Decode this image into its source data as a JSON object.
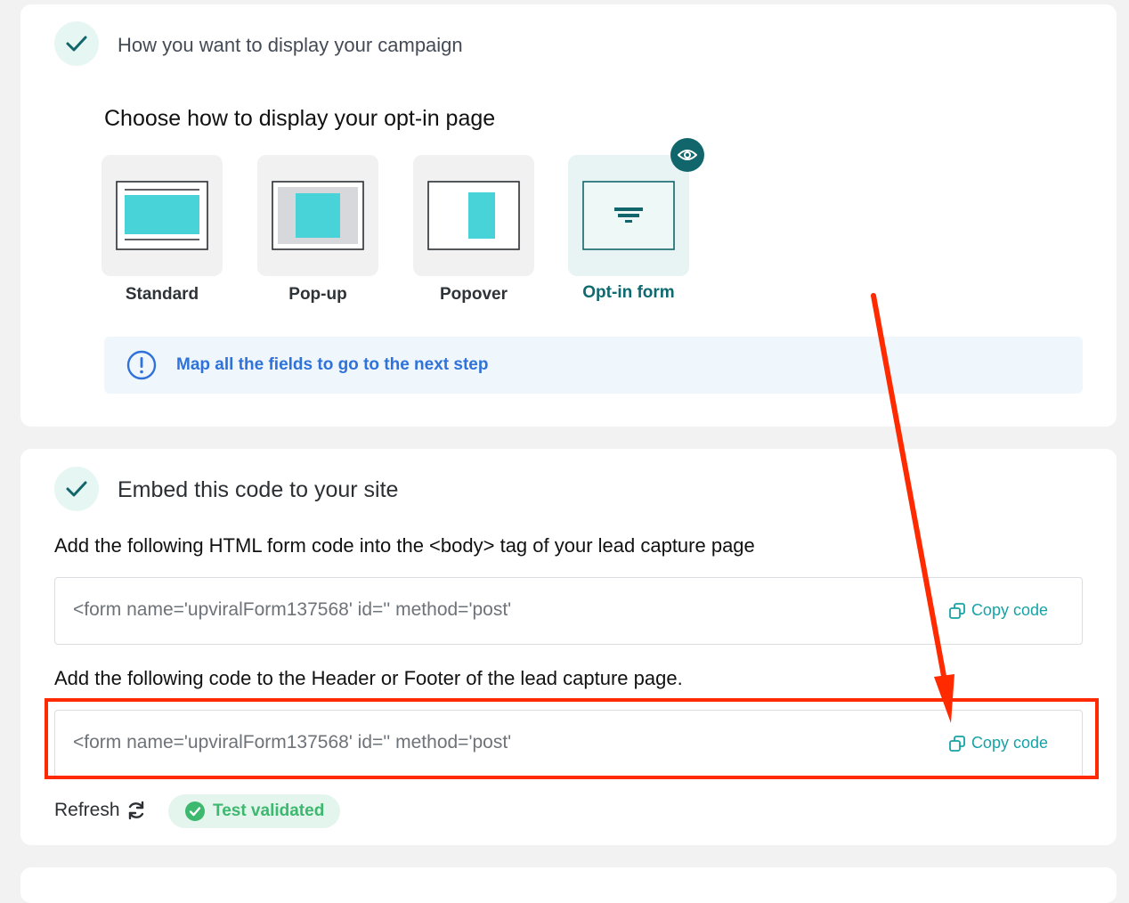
{
  "section_display": {
    "title": "How you want to display your campaign",
    "subheading": "Choose how to display your opt-in page",
    "options": [
      {
        "label": "Standard"
      },
      {
        "label": "Pop-up"
      },
      {
        "label": "Popover"
      },
      {
        "label": "Opt-in form",
        "selected": true
      }
    ],
    "info_message": "Map all the fields to go to the next step"
  },
  "section_embed": {
    "title": "Embed this code to your site",
    "instruction_body": "Add the following HTML form code into the <body> tag of your lead capture page",
    "body_code": "<form name='upviralForm137568' id='' method='post'",
    "instruction_header": "Add the following code to the Header or Footer of the lead capture page.",
    "header_code": "<form name='upviralForm137568' id='' method='post'",
    "copy_label": "Copy code",
    "refresh_label": "Refresh",
    "status_label": "Test validated"
  },
  "colors": {
    "accent_teal": "#11666c",
    "tile_cyan": "#48d3d8",
    "info_blue": "#2f72d9",
    "success_green": "#3db86f",
    "annotation_red": "#ff2a00"
  },
  "icons": [
    "check-icon",
    "eye-icon",
    "info-icon",
    "copy-icon",
    "refresh-icon",
    "check-circle-icon"
  ]
}
